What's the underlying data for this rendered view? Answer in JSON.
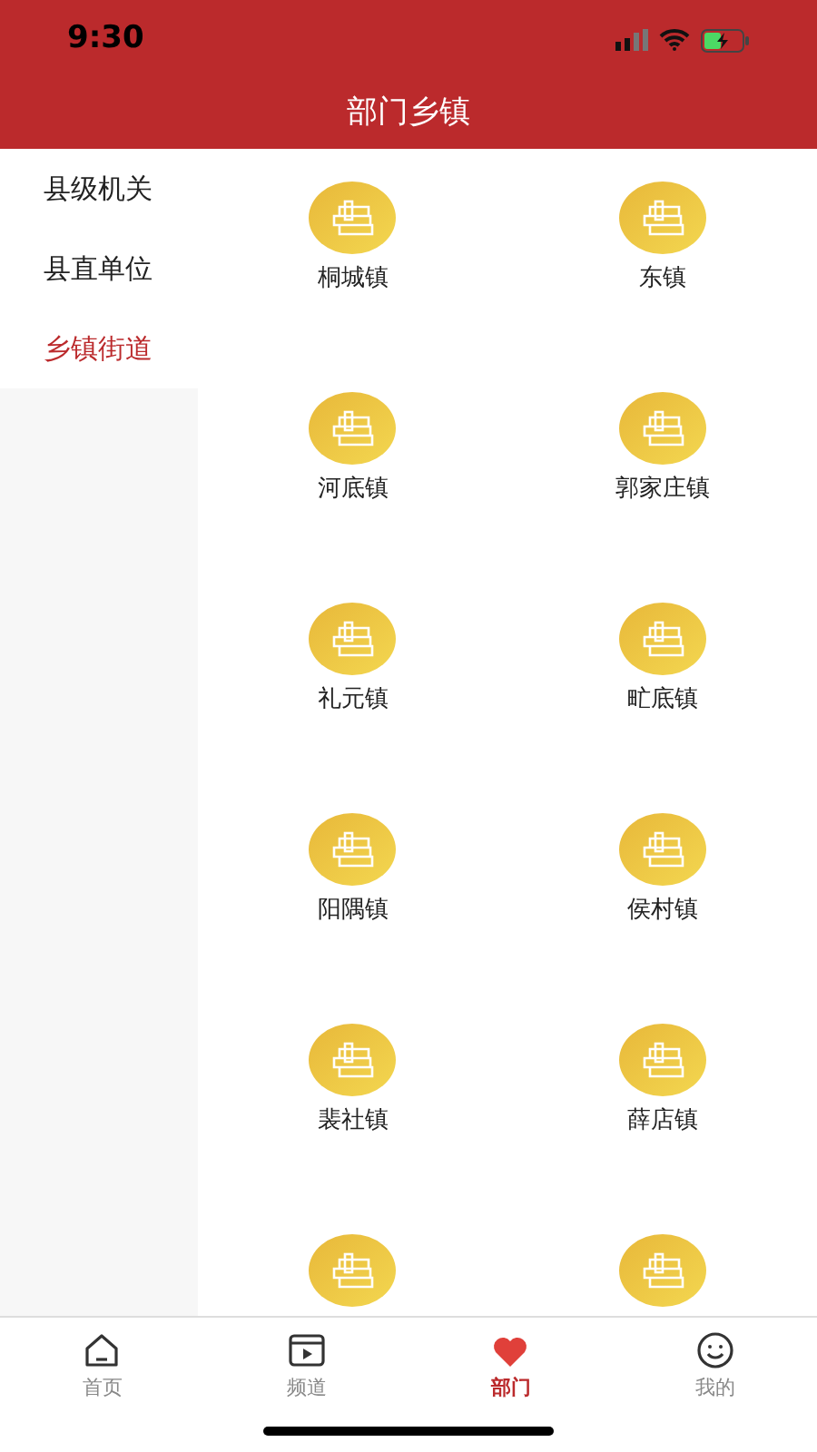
{
  "status_bar": {
    "time": "9:30"
  },
  "header": {
    "title": "部门乡镇"
  },
  "sidebar": {
    "items": [
      {
        "label": "县级机关",
        "selected": false
      },
      {
        "label": "县直单位",
        "selected": false
      },
      {
        "label": "乡镇街道",
        "selected": true
      }
    ]
  },
  "grid": {
    "items": [
      {
        "kind": "town",
        "label": "桐城镇"
      },
      {
        "kind": "town",
        "label": "东镇"
      },
      {
        "kind": "town",
        "label": "河底镇"
      },
      {
        "kind": "town",
        "label": "郭家庄镇"
      },
      {
        "kind": "town",
        "label": "礼元镇"
      },
      {
        "kind": "town",
        "label": "甿底镇"
      },
      {
        "kind": "town",
        "label": "阳隅镇"
      },
      {
        "kind": "town",
        "label": "侯村镇"
      },
      {
        "kind": "town",
        "label": "裴社镇"
      },
      {
        "kind": "town",
        "label": "薛店镇"
      },
      {
        "kind": "town"
      },
      {
        "kind": "town"
      }
    ]
  },
  "tab_bar": {
    "tabs": [
      {
        "label": "首页",
        "kind": "home",
        "selected": false
      },
      {
        "label": "频道",
        "kind": "channel",
        "selected": false
      },
      {
        "label": "部门",
        "kind": "heart",
        "selected": true
      },
      {
        "label": "我的",
        "kind": "smile",
        "selected": false
      }
    ]
  }
}
